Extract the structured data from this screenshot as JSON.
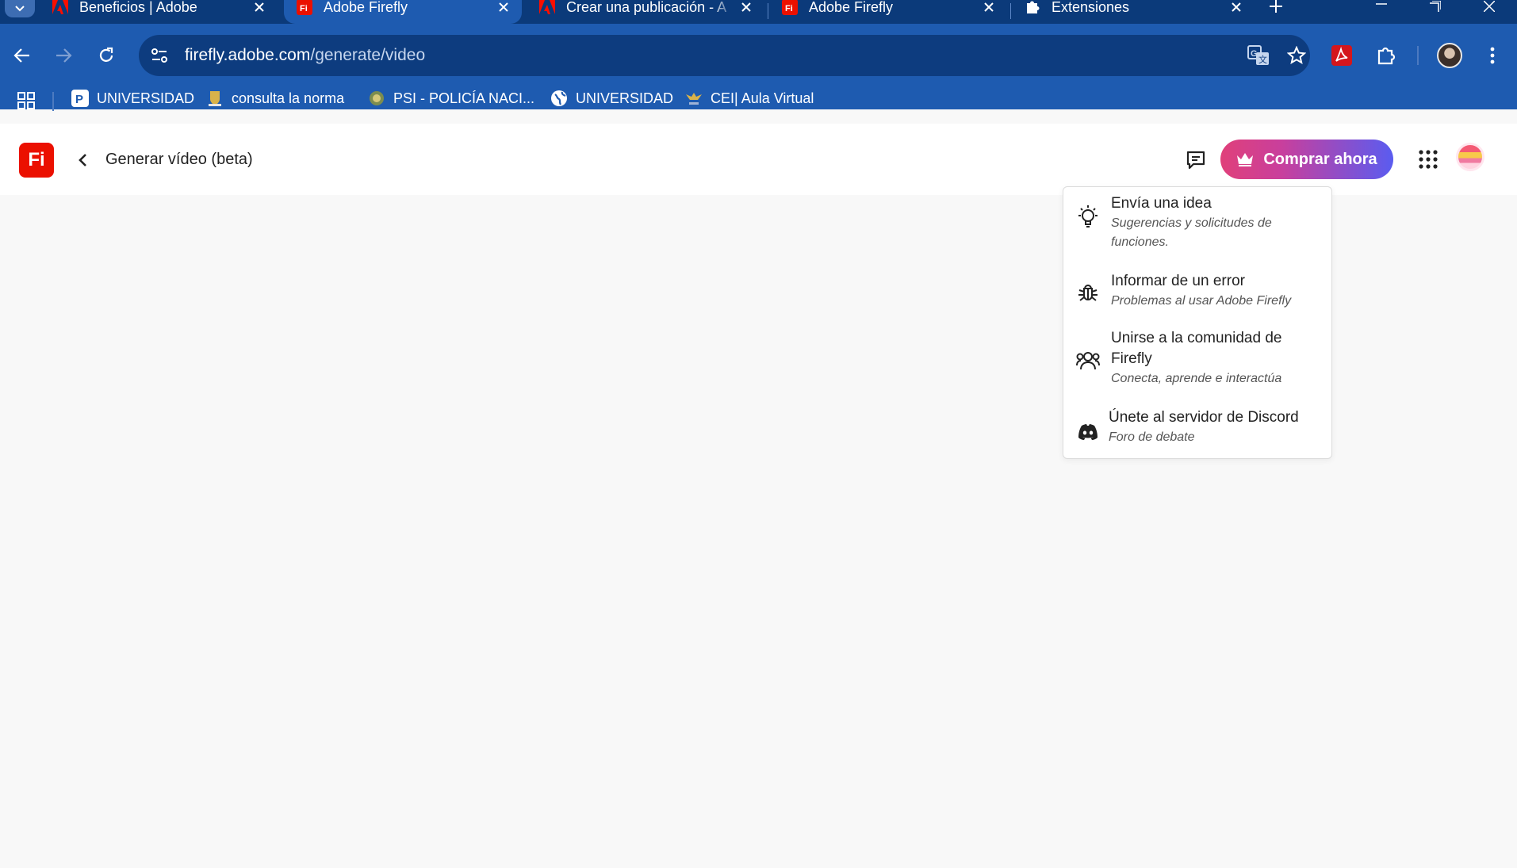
{
  "browser": {
    "tabs": [
      {
        "title": "Beneficios | Adobe",
        "icon": "adobe-icon",
        "active": false
      },
      {
        "title": "Adobe Firefly",
        "icon": "firefly-icon",
        "active": true
      },
      {
        "title": "Crear una publicación - A",
        "icon": "adobe-icon",
        "active": false
      },
      {
        "title": "Adobe Firefly",
        "icon": "firefly-icon",
        "active": false
      },
      {
        "title": "Extensiones",
        "icon": "puzzle-icon",
        "active": false
      }
    ],
    "address": {
      "host": "firefly.adobe.com",
      "path": "/generate/video"
    },
    "bookmarks": [
      {
        "label": "UNIVERSIDAD",
        "icon": "universidad-logo-icon"
      },
      {
        "label": "consulta la norma",
        "icon": "coat-of-arms-icon"
      },
      {
        "label": "PSI - POLICÍA NACI...",
        "icon": "police-badge-icon"
      },
      {
        "label": "UNIVERSIDAD",
        "icon": "globe-icon"
      },
      {
        "label": "CEI| Aula Virtual",
        "icon": "eagle-emblem-icon"
      }
    ]
  },
  "app": {
    "logo_text": "Fi",
    "page_title": "Generar vídeo (beta)",
    "buy_label": "Comprar ahora",
    "accent": "#eb1000"
  },
  "feedback_menu": {
    "items": [
      {
        "title": "Envía una idea",
        "description": "Sugerencias y solicitudes de funciones.",
        "icon": "lightbulb-icon"
      },
      {
        "title": "Informar de un error",
        "description": "Problemas al usar Adobe Firefly",
        "icon": "bug-icon"
      },
      {
        "title": "Unirse a la comunidad de Firefly",
        "description": "Conecta, aprende e interactúa",
        "icon": "community-icon"
      },
      {
        "title": "Únete al servidor de Discord",
        "description": "Foro de debate",
        "icon": "discord-icon"
      }
    ]
  }
}
